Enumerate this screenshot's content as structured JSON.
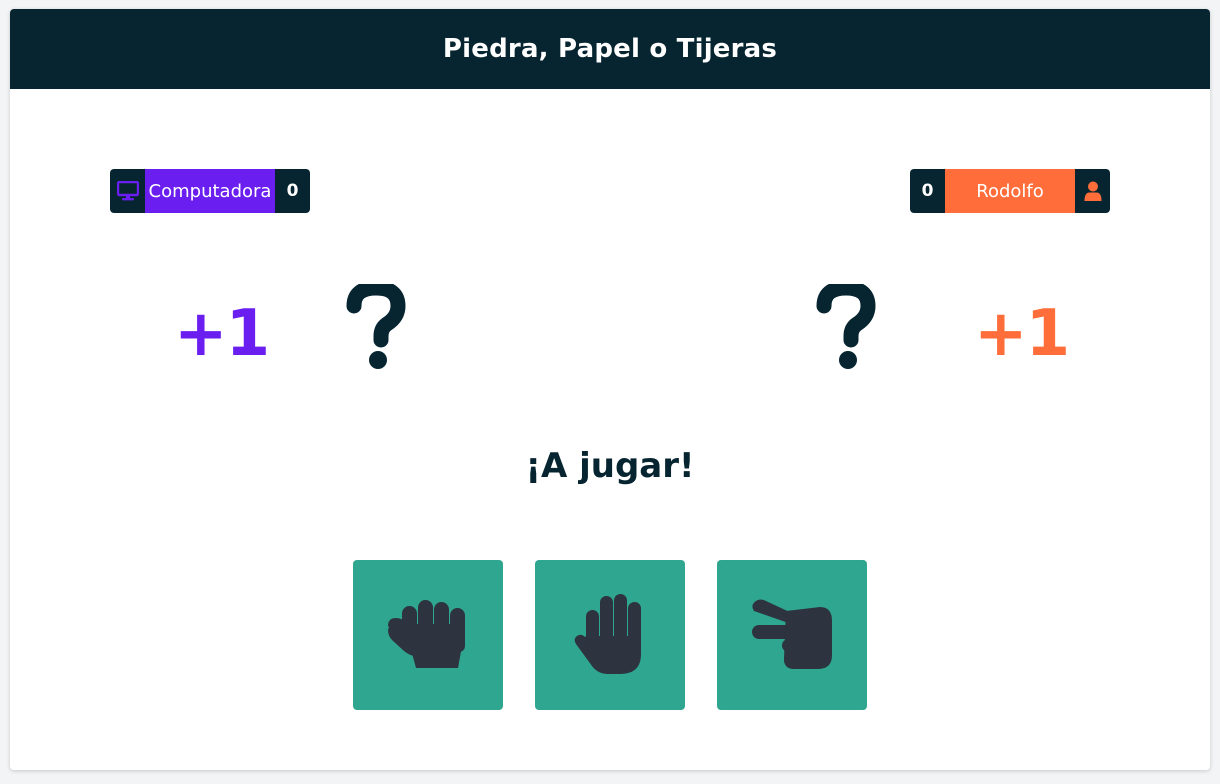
{
  "header": {
    "title": "Piedra, Papel o Tijeras"
  },
  "computer": {
    "name": "Computadora",
    "score": "0",
    "icon": "monitor-icon",
    "color": "#6a1ff0",
    "round_bonus": "+1",
    "choice_icon": "question-mark-icon"
  },
  "player": {
    "name": "Rodolfo",
    "score": "0",
    "icon": "user-icon",
    "color": "#ff6e3a",
    "round_bonus": "+1",
    "choice_icon": "question-mark-icon"
  },
  "status": {
    "message": "¡A jugar!"
  },
  "choices": [
    {
      "id": "rock",
      "icon": "fist-icon"
    },
    {
      "id": "paper",
      "icon": "open-hand-icon"
    },
    {
      "id": "scissors",
      "icon": "peace-hand-icon"
    }
  ],
  "colors": {
    "dark": "#062530",
    "button": "#2fa68f",
    "hand": "#2d333f"
  }
}
